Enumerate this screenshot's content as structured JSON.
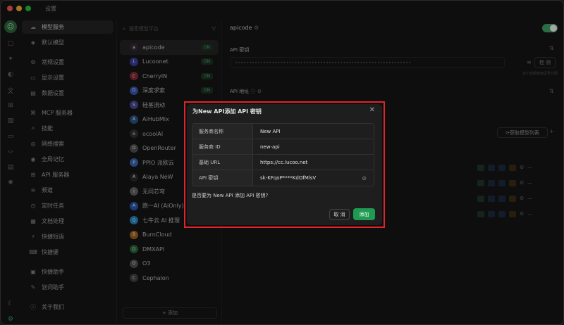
{
  "window": {
    "title": "设置"
  },
  "menu": {
    "items": [
      {
        "label": "模型服务",
        "icon": "cloud-icon",
        "glyph": "☁",
        "active": true
      },
      {
        "label": "默认模型",
        "icon": "cube-icon",
        "glyph": "◈"
      },
      {
        "sep": true
      },
      {
        "label": "常规设置",
        "icon": "settings-icon",
        "glyph": "⚙"
      },
      {
        "label": "显示设置",
        "icon": "monitor-icon",
        "glyph": "▭"
      },
      {
        "label": "数据设置",
        "icon": "database-icon",
        "glyph": "▤"
      },
      {
        "sep": true
      },
      {
        "label": "MCP 服务器",
        "icon": "server-icon",
        "glyph": "⌘"
      },
      {
        "label": "技能",
        "icon": "skill-icon",
        "glyph": "✧"
      },
      {
        "label": "网络搜索",
        "icon": "globe-icon",
        "glyph": "◎"
      },
      {
        "label": "全局记忆",
        "icon": "memory-icon",
        "glyph": "◉"
      },
      {
        "label": "API 服务器",
        "icon": "api-icon",
        "glyph": "⊞"
      },
      {
        "label": "频道",
        "icon": "channel-icon",
        "glyph": "≋"
      },
      {
        "label": "定时任务",
        "icon": "clock-icon",
        "glyph": "◷"
      },
      {
        "label": "文档处理",
        "icon": "document-icon",
        "glyph": "▦"
      },
      {
        "label": "快捷短语",
        "icon": "phrase-icon",
        "glyph": "⚡"
      },
      {
        "label": "快捷键",
        "icon": "keyboard-icon",
        "glyph": "⌨"
      },
      {
        "sep": true
      },
      {
        "label": "快捷助手",
        "icon": "assistant-icon",
        "glyph": "▣"
      },
      {
        "label": "划词助手",
        "icon": "text-select-icon",
        "glyph": "✎"
      },
      {
        "sep": true
      },
      {
        "label": "关于我们",
        "icon": "info-icon",
        "glyph": "ⓘ"
      }
    ]
  },
  "providers": {
    "search_placeholder": "搜索模型平台",
    "add_label": "+ 添加",
    "items": [
      {
        "name": "apicode",
        "on": "ON",
        "color": "#3a2a3a",
        "glyph": "a",
        "active": true
      },
      {
        "name": "Lucoonet",
        "on": "ON",
        "color": "#3b3fa8",
        "glyph": "L"
      },
      {
        "name": "CherryIN",
        "on": "ON",
        "color": "#8a2a3a",
        "glyph": "C"
      },
      {
        "name": "深度求索",
        "on": "ON",
        "color": "#3a5bb8",
        "glyph": "D"
      },
      {
        "name": "硅基流动",
        "color": "#4a4a9a",
        "glyph": "S"
      },
      {
        "name": "AiHubMix",
        "color": "#2a5a8a",
        "glyph": "A"
      },
      {
        "name": "ocoolAI",
        "color": "#333333",
        "glyph": "o"
      },
      {
        "name": "OpenRouter",
        "color": "#555555",
        "glyph": "O"
      },
      {
        "name": "PPIO 派欧云",
        "color": "#3a6ab8",
        "glyph": "P"
      },
      {
        "name": "Alaya NeW",
        "color": "#2a2a2a",
        "glyph": "A"
      },
      {
        "name": "无问芯穹",
        "color": "#666666",
        "glyph": "I"
      },
      {
        "name": "跑一AI (AiOnly)",
        "color": "#2a5ab8",
        "glyph": "A"
      },
      {
        "name": "七牛云 AI 推理",
        "color": "#2a8ac8",
        "glyph": "Q"
      },
      {
        "name": "BurnCloud",
        "color": "#a8661a",
        "glyph": "B"
      },
      {
        "name": "DMXAPI",
        "color": "#2a6a3a",
        "glyph": "D"
      },
      {
        "name": "O3",
        "color": "#555555",
        "glyph": "O"
      },
      {
        "name": "Cephalon",
        "color": "#444444",
        "glyph": "C"
      }
    ]
  },
  "main": {
    "provider_name": "apicode",
    "api_key_label": "API 密钥",
    "api_key_masked": "••••••••••••••••••••••••••••••••••••••••••••••••••••••••••••••",
    "check_label": "检 测",
    "hint": "多个密钥使用逗号分隔",
    "api_url_label": "API 地址",
    "models_button": "获取模型列表"
  },
  "dialog": {
    "title": "为New API添加 API 密钥",
    "rows": [
      {
        "key": "服务商名称",
        "value": "New API"
      },
      {
        "key": "服务商 ID",
        "value": "new-api"
      },
      {
        "key": "基础 URL",
        "value": "https://cc.lucoo.net"
      },
      {
        "key": "API 密钥",
        "value": "sk-KFqoP****KdOfMlsV"
      }
    ],
    "question": "是否要为 New API 添加 API 密钥?",
    "cancel": "取 消",
    "add": "添加"
  }
}
